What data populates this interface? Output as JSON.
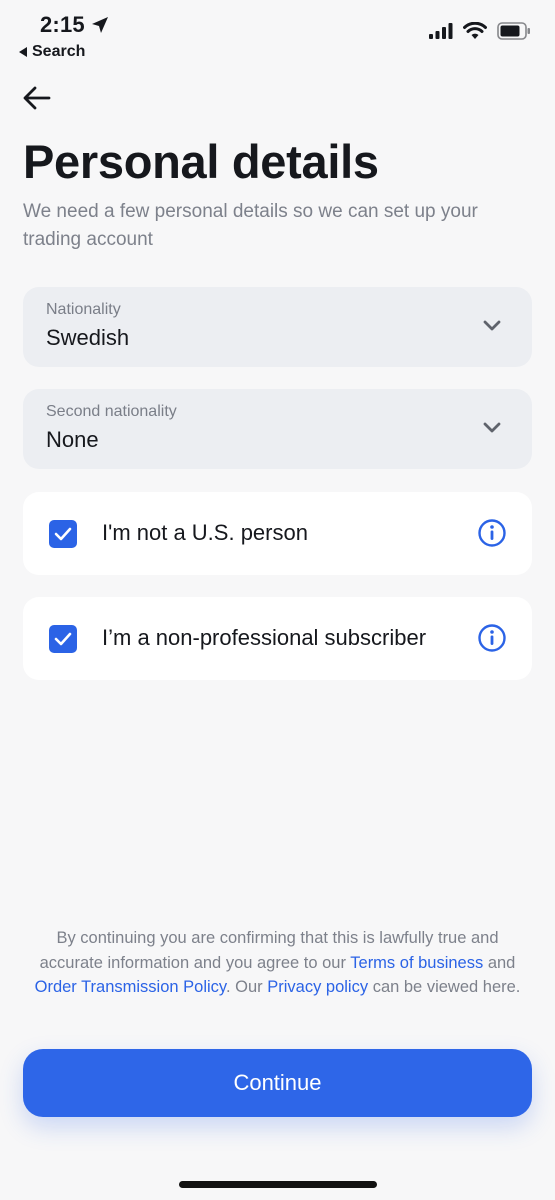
{
  "status_bar": {
    "time": "2:15",
    "back_label": "Search"
  },
  "header": {
    "title": "Personal details",
    "subtitle": "We need a few personal details so we can set up your trading account"
  },
  "fields": {
    "nationality": {
      "label": "Nationality",
      "value": "Swedish"
    },
    "second_nationality": {
      "label": "Second nationality",
      "value": "None"
    }
  },
  "checks": {
    "not_us_person": {
      "label": "I'm not a U.S. person",
      "checked": true
    },
    "non_professional": {
      "label": "I’m a non-professional subscriber",
      "checked": true
    }
  },
  "disclaimer": {
    "part1": "By continuing you are confirming that this is lawfully true and accurate information and you agree to our ",
    "terms_link": "Terms of business",
    "part2": " and ",
    "order_link": "Order Transmission Policy",
    "part3": ". Our ",
    "privacy_link": "Privacy policy",
    "part4": " can be viewed here."
  },
  "actions": {
    "continue_label": "Continue"
  },
  "colors": {
    "accent": "#2e66e8",
    "background": "#f7f7f8",
    "field_bg": "#eceef2",
    "muted_text": "#7d818b"
  },
  "icons": {
    "location": "location-arrow-icon",
    "back": "arrow-left-icon",
    "chevron": "chevron-down-icon",
    "check": "checkmark-icon",
    "info": "info-circle-icon"
  }
}
